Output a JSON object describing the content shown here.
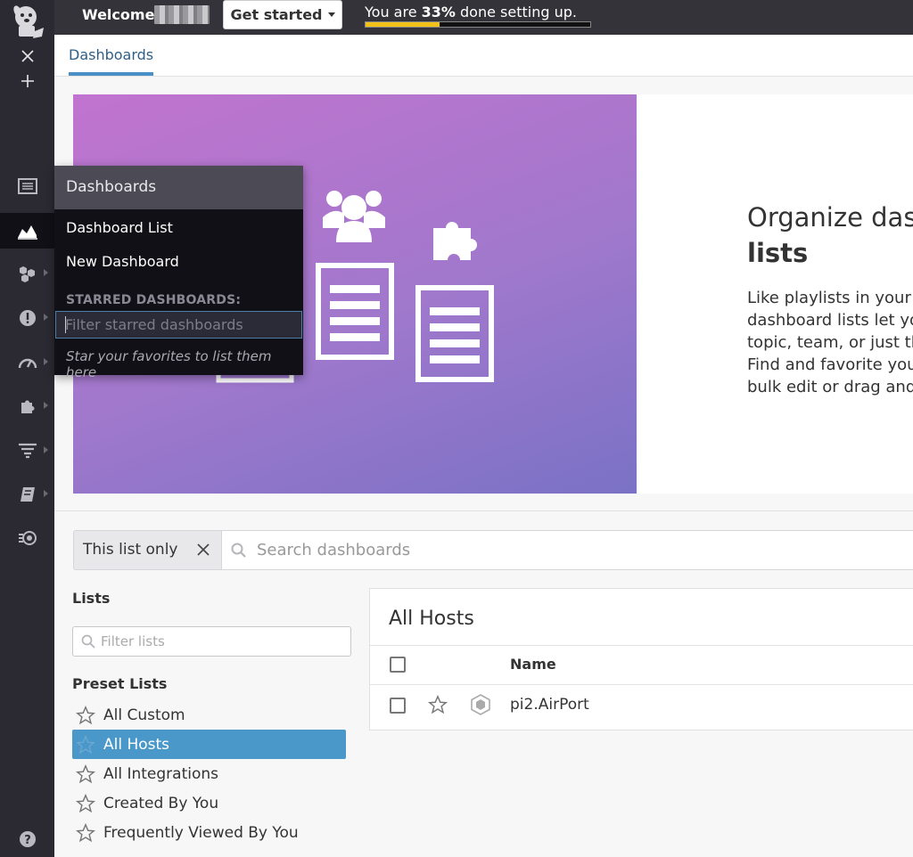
{
  "topbar": {
    "welcome": "Welcome,",
    "get_started": "Get started",
    "progress_prefix": "You are ",
    "progress_percent": "33%",
    "progress_suffix": " done setting up.",
    "progress_fraction": 0.33,
    "progress_color": "#f2c21b"
  },
  "tabs": {
    "active": "Dashboards"
  },
  "hero": {
    "title_line1": "Organize dash",
    "title_line2": "lists",
    "body": [
      "Like playlists in your f",
      "dashboard lists let yo",
      "topic, team, or just th",
      "Find and favorite you",
      "bulk edit or drag and"
    ]
  },
  "search": {
    "scope_label": "This list only",
    "placeholder": "Search dashboards"
  },
  "lists": {
    "heading": "Lists",
    "filter_placeholder": "Filter lists",
    "preset_heading": "Preset Lists",
    "items": [
      {
        "label": "All Custom",
        "selected": false
      },
      {
        "label": "All Hosts",
        "selected": true
      },
      {
        "label": "All Integrations",
        "selected": false
      },
      {
        "label": "Created By You",
        "selected": false
      },
      {
        "label": "Frequently Viewed By You",
        "selected": false
      }
    ],
    "selected_color": "#4a97c9"
  },
  "table": {
    "title": "All Hosts",
    "column_name": "Name",
    "rows": [
      {
        "name": "pi2.AirPort"
      }
    ]
  },
  "dropdown": {
    "heading": "Dashboards",
    "items": [
      "Dashboard List",
      "New Dashboard"
    ],
    "starred_label": "STARRED DASHBOARDS:",
    "filter_placeholder": "Filter starred dashboards",
    "hint": "Star your favorites to list them here"
  },
  "sidebar_icons": [
    "datadog-logo-icon",
    "close-icon",
    "plus-icon",
    "events-icon",
    "dashboards-icon",
    "infrastructure-icon",
    "monitors-icon",
    "apm-icon",
    "integrations-icon",
    "logs-icon",
    "notebooks-icon",
    "synthetics-icon",
    "help-icon"
  ]
}
